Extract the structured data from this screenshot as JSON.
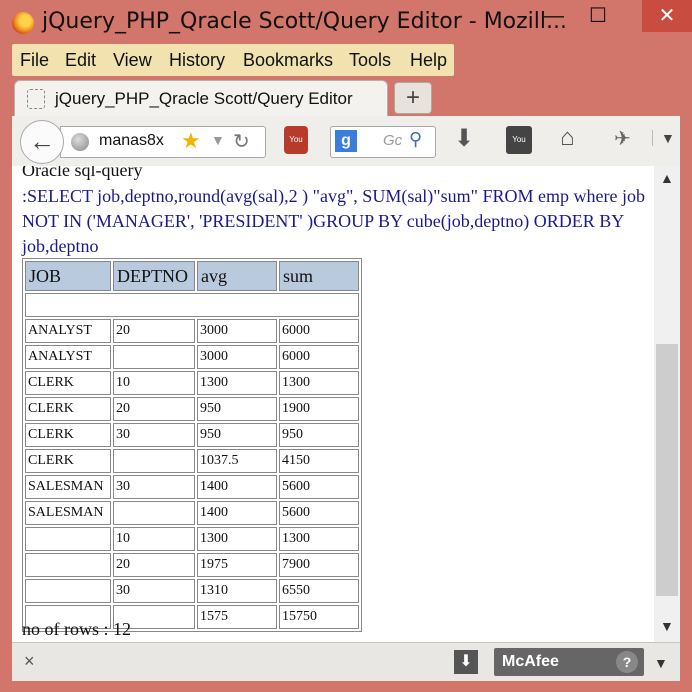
{
  "window": {
    "title": "jQuery_PHP_Qracle Scott/Query Editor - Mozill...",
    "min_label": "—",
    "max_label": "☐",
    "close_label": "✕"
  },
  "menubar": {
    "items": [
      "File",
      "Edit",
      "View",
      "History",
      "Bookmarks",
      "Tools",
      "Help"
    ]
  },
  "tab": {
    "label": "jQuery_PHP_Qracle Scott/Query Editor",
    "newtab_label": "+"
  },
  "navbar": {
    "url": "manas8x",
    "search_placeholder": "Gc"
  },
  "page": {
    "heading": "Oracle sql-query",
    "query": ":SELECT job,deptno,round(avg(sal),2 ) \"avg\", SUM(sal)\"sum\" FROM emp where job NOT IN ('MANAGER', 'PRESIDENT' )GROUP BY cube(job,deptno) ORDER BY job,deptno",
    "table": {
      "headers": [
        "JOB",
        "DEPTNO",
        "avg",
        "sum"
      ],
      "rows": [
        [
          "ANALYST",
          "20",
          "3000",
          "6000"
        ],
        [
          "ANALYST",
          "",
          "3000",
          "6000"
        ],
        [
          "CLERK",
          "10",
          "1300",
          "1300"
        ],
        [
          "CLERK",
          "20",
          "950",
          "1900"
        ],
        [
          "CLERK",
          "30",
          "950",
          "950"
        ],
        [
          "CLERK",
          "",
          "1037.5",
          "4150"
        ],
        [
          "SALESMAN",
          "30",
          "1400",
          "5600"
        ],
        [
          "SALESMAN",
          "",
          "1400",
          "5600"
        ],
        [
          "",
          "10",
          "1300",
          "1300"
        ],
        [
          "",
          "20",
          "1975",
          "7900"
        ],
        [
          "",
          "30",
          "1310",
          "6550"
        ],
        [
          "",
          "",
          "1575",
          "15750"
        ]
      ]
    },
    "footer": "no of rows : 12"
  },
  "addonbar": {
    "close_label": "×",
    "mcafee_label": "McAfee",
    "help_label": "?"
  },
  "icons": {
    "app": "firefox-icon",
    "back": "back-arrow-icon",
    "search_engine": "google-icon",
    "download": "download-icon",
    "home": "home-icon"
  }
}
